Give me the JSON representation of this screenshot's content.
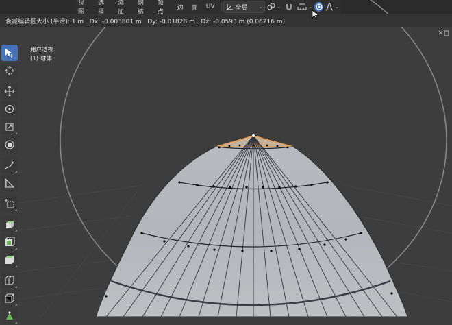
{
  "header": {
    "menu": [
      "视图",
      "选择",
      "添加",
      "网格",
      "顶点",
      "边",
      "面",
      "UV"
    ],
    "transform_orientation": "全局"
  },
  "status": {
    "text": "衰减编辑区大小 (平滑): 1 m   Dx: -0.003801 m   Dy: -0.01828 m   Dz: -0.0593 m (0.06216 m)"
  },
  "viewport": {
    "view_label": "用户透视",
    "object_label": "(1) 球体"
  },
  "toolbar": {
    "tools": [
      "select-box",
      "cursor",
      "move",
      "rotate",
      "scale",
      "transform",
      "annotate",
      "measure",
      "add-cube",
      "extrude-region",
      "inset-faces",
      "bevel",
      "loop-cut",
      "knife",
      "poly-build"
    ],
    "active": "select-box"
  },
  "colors": {
    "background": "#3d3d3d",
    "mesh_face": "#b4b8bc",
    "wire": "#1c1c1c",
    "selection": "#e59a4c",
    "active_button": "#4772b3",
    "falloff_circle": "#8a8a8a"
  }
}
